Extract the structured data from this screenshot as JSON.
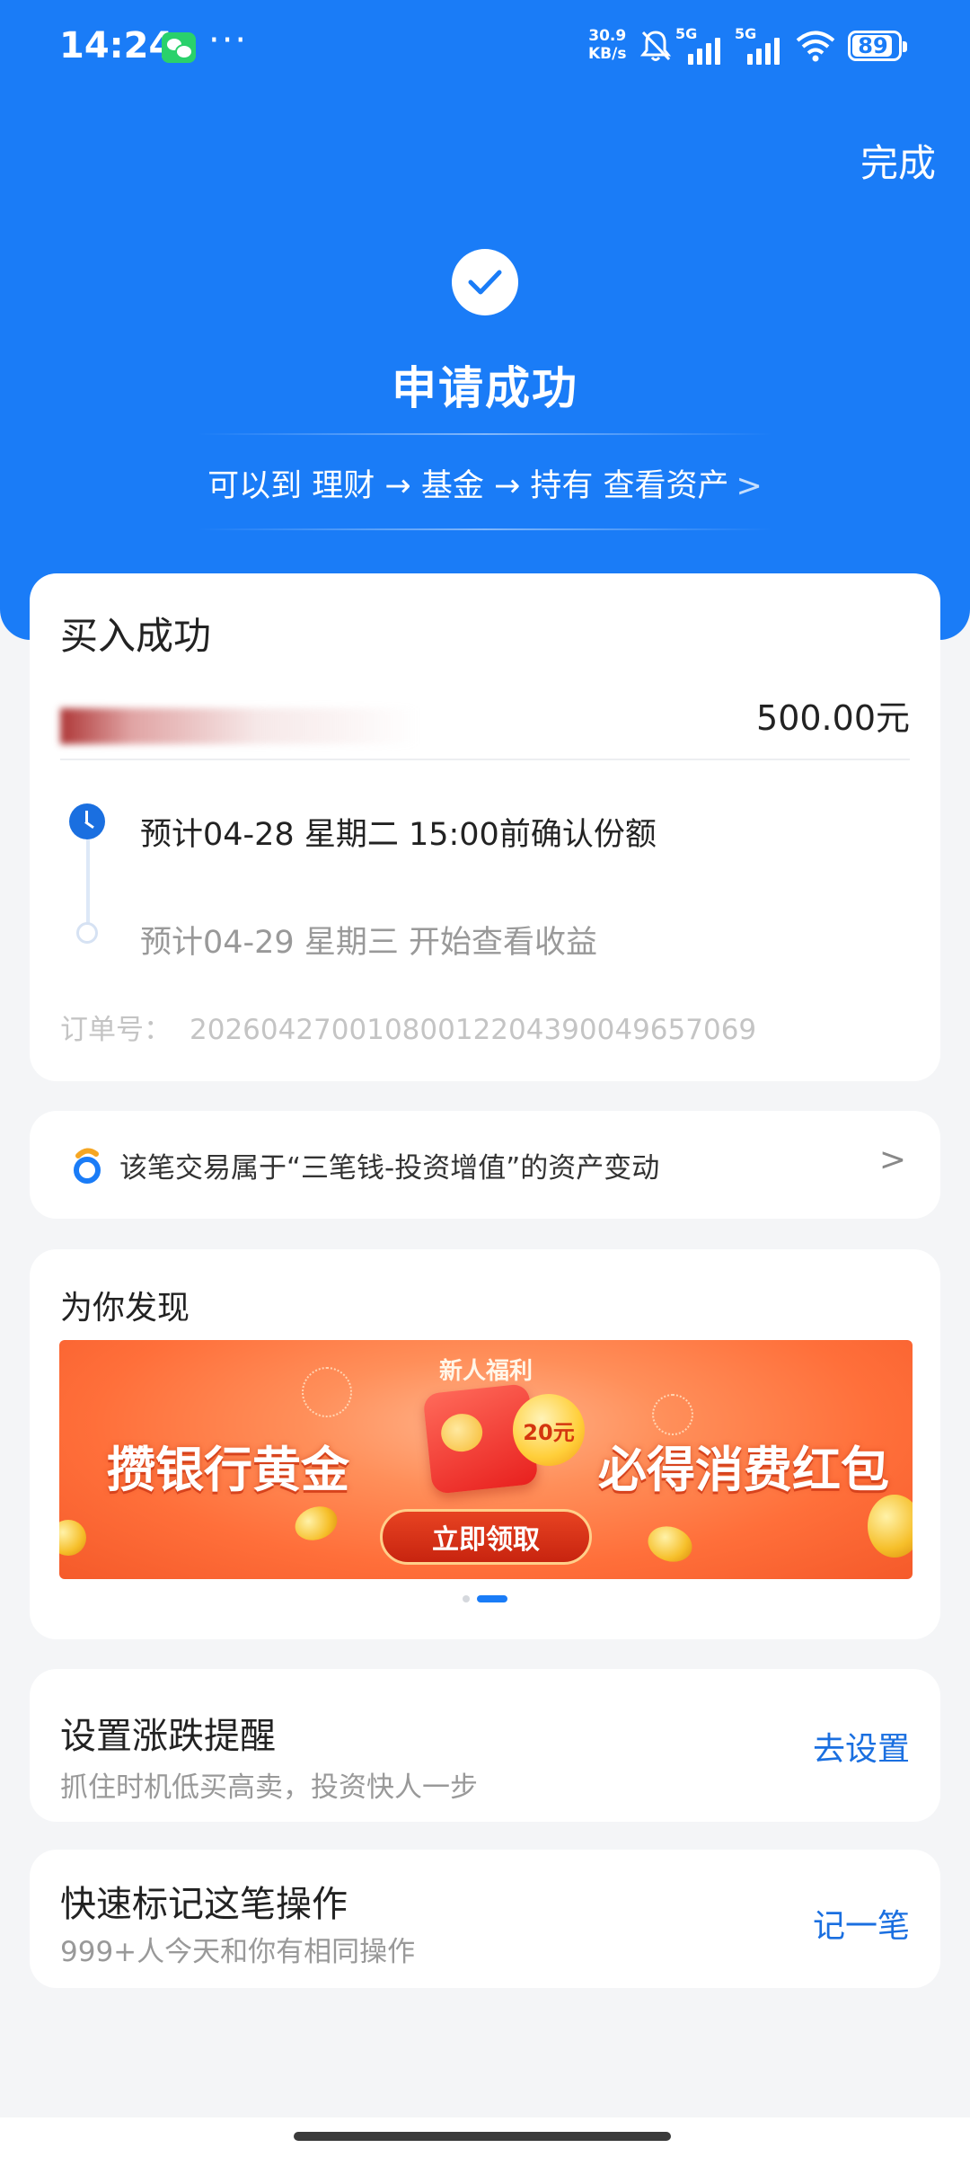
{
  "status_bar": {
    "time": "14:24",
    "dots": "···",
    "net_speed_value": "30.9",
    "net_speed_unit": "KB/s",
    "signal_1_label": "5G",
    "signal_2_label": "5G",
    "battery": "89",
    "icons": [
      "wechat-icon",
      "bell-muted-icon",
      "signal-icon",
      "wifi-icon",
      "battery-icon"
    ]
  },
  "header": {
    "done_label": "完成",
    "success_title": "申请成功",
    "hint": "可以到 理财 → 基金 → 持有 查看资产",
    "hint_chevron": ">",
    "accent_color": "#1a7cf7"
  },
  "purchase": {
    "title": "买入成功",
    "amount": "500.00元",
    "steps": [
      {
        "text": "预计04-28 星期二 15:00前确认份额",
        "icon": "clock-icon",
        "state": "current"
      },
      {
        "text": "预计04-29 星期三 开始查看收益",
        "icon": "dot-icon",
        "state": "pending"
      }
    ],
    "order_label": "订单号：",
    "order_number": "20260427001080012204390049657069"
  },
  "asset_link": {
    "text": "该笔交易属于“三笔钱-投资增值”的资产变动",
    "chevron": ">"
  },
  "discover": {
    "title": "为你发现",
    "banner": {
      "top_label": "新人福利",
      "left_text": "攒银行黄金",
      "right_text": "必得消费红包",
      "coupon": "20元",
      "button_label": "立即领取"
    },
    "pager": {
      "count": 2,
      "active_index": 1
    }
  },
  "alert_card": {
    "title": "设置涨跌提醒",
    "subtitle": "抓住时机低买高卖，投资快人一步",
    "link_label": "去设置"
  },
  "mark_card": {
    "title": "快速标记这笔操作",
    "subtitle": "999+人今天和你有相同操作",
    "link_label": "记一笔"
  }
}
